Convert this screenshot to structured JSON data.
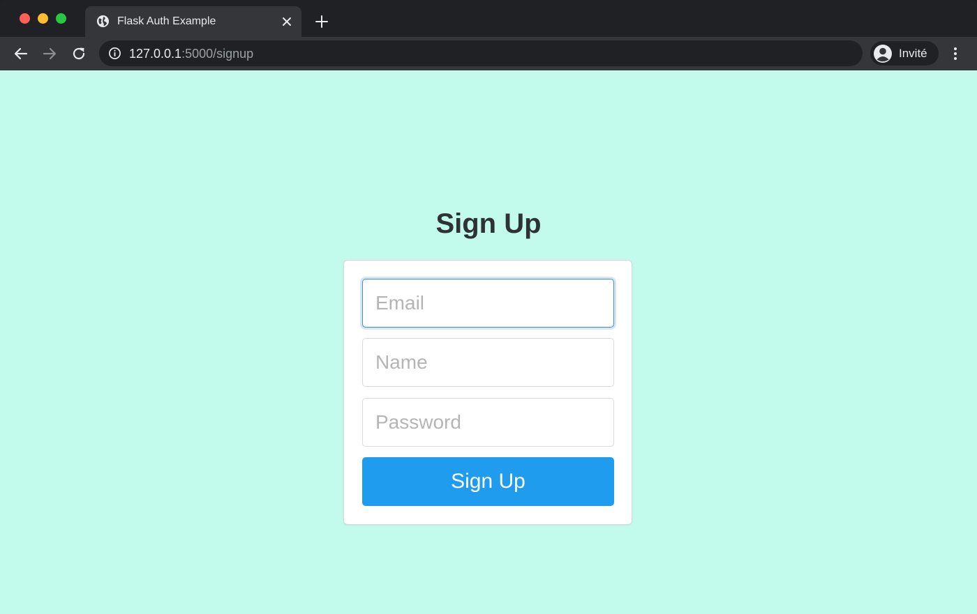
{
  "browser": {
    "tab": {
      "title": "Flask Auth Example",
      "favicon": "globe-icon"
    },
    "address": {
      "host": "127.0.0.1",
      "path": ":5000/signup"
    },
    "profile": {
      "label": "Invité"
    }
  },
  "page": {
    "title": "Sign Up",
    "form": {
      "email_placeholder": "Email",
      "name_placeholder": "Name",
      "password_placeholder": "Password",
      "submit_label": "Sign Up"
    }
  },
  "colors": {
    "background": "#c2fbeb",
    "button": "#209cee",
    "focus_border": "#3e8ed0"
  }
}
